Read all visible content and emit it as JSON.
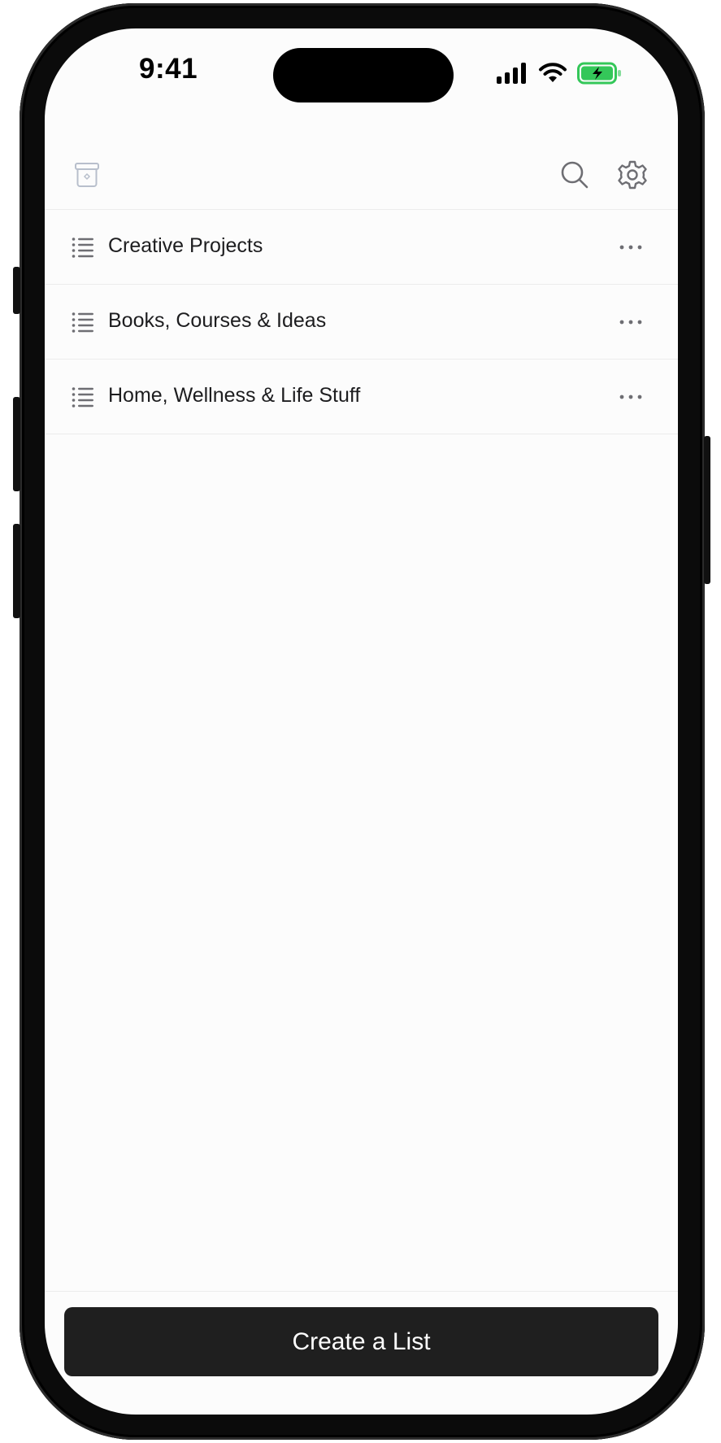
{
  "status_bar": {
    "time": "9:41",
    "battery_color": "#34c759"
  },
  "header": {
    "archive_icon": "archive-box-icon",
    "search_icon": "search-icon",
    "settings_icon": "gear-icon"
  },
  "lists": [
    {
      "label": "Creative Projects",
      "icon": "list-icon",
      "menu_icon": "more-icon"
    },
    {
      "label": "Books, Courses & Ideas",
      "icon": "list-icon",
      "menu_icon": "more-icon"
    },
    {
      "label": "Home, Wellness & Life Stuff",
      "icon": "list-icon",
      "menu_icon": "more-icon"
    }
  ],
  "footer": {
    "create_button_label": "Create a List"
  },
  "colors": {
    "button_bg": "#1f1f1f",
    "icon_gray": "#6e6e73",
    "archive_icon": "#b8bfcc"
  }
}
